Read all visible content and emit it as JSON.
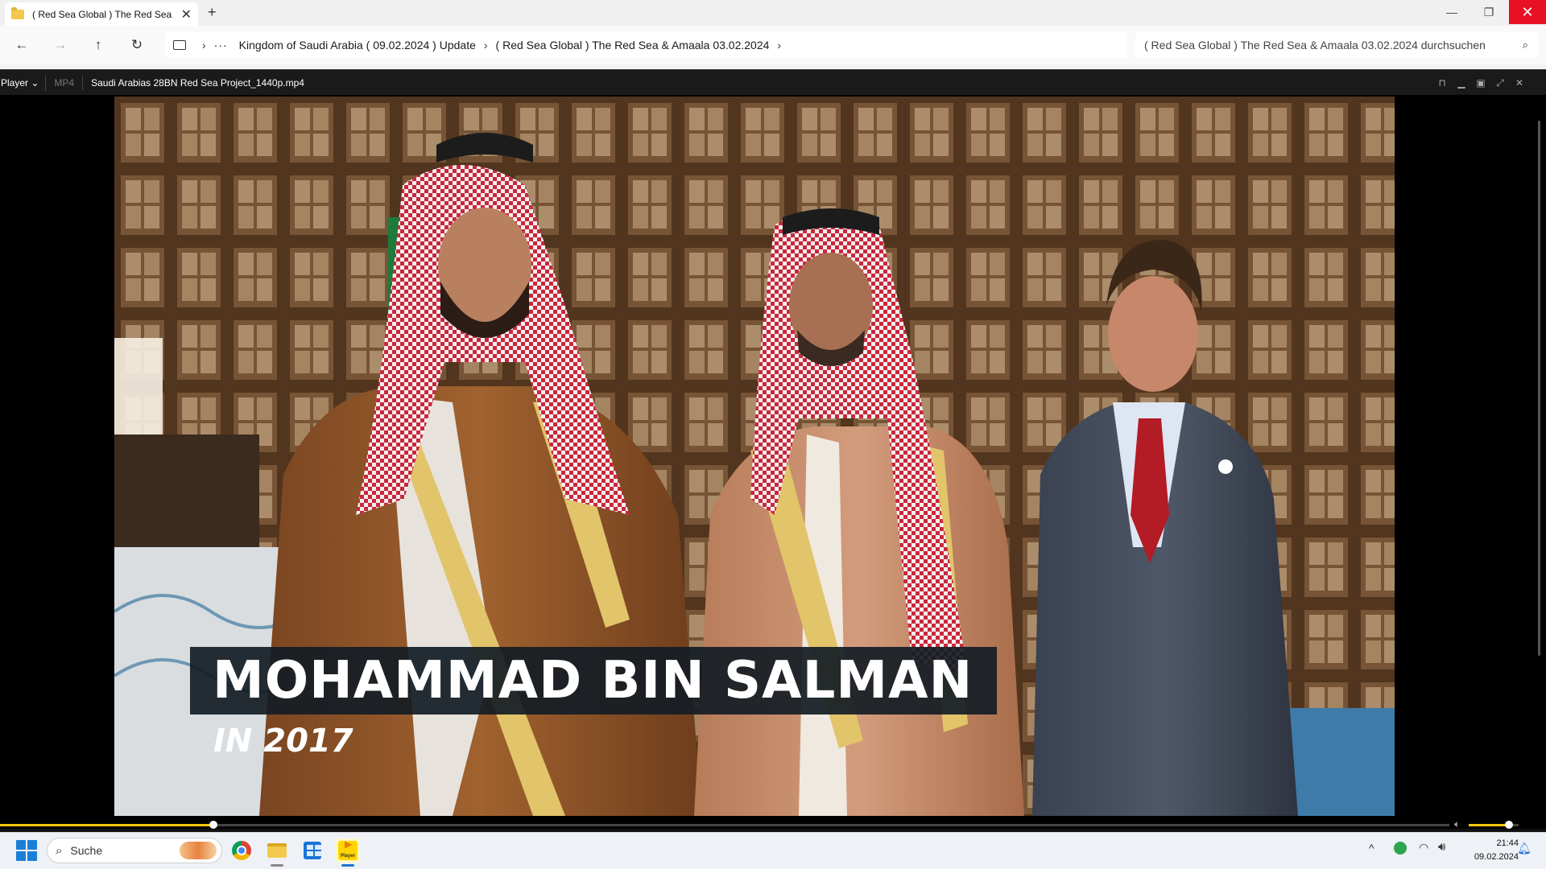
{
  "window": {
    "tab_title": "( Red Sea Global ) The Red Sea",
    "tab_close": "✕",
    "new_tab": "+",
    "minimize": "—",
    "restore": "❐",
    "close": "✕"
  },
  "nav": {
    "back": "←",
    "forward": "→",
    "up": "↑",
    "refresh": "↻",
    "more": "···",
    "breadcrumbs": [
      "Kingdom of Saudi Arabia ( 09.02.2024 ) Update",
      "( Red Sea Global ) The Red Sea & Amaala 03.02.2024"
    ],
    "separator": "›",
    "search_placeholder": "( Red Sea Global ) The Red Sea & Amaala 03.02.2024 durchsuchen",
    "search_icon": "search-icon"
  },
  "player": {
    "menu_label": "Player ⌄",
    "format": "MP4",
    "filename": "Saudi Arabias 28BN Red Sea Project_1440p.mp4",
    "controls": [
      "pin-icon",
      "minimize-icon",
      "maximize-icon",
      "fullscreen-icon",
      "close-icon"
    ],
    "progress_fraction": 0.147,
    "volume_fraction": 0.8,
    "accent_color": "#f1c40f"
  },
  "video": {
    "caption_name": "MOHAMMAD BIN SALMAN",
    "caption_year": "IN 2017"
  },
  "taskbar": {
    "search_label": "Suche",
    "apps": [
      "start-icon",
      "chrome-icon",
      "file-explorer-icon",
      "store-icon",
      "player-icon"
    ],
    "player_app_label": "Player",
    "time": "21:44",
    "date": "09.02.2024",
    "tray_chevron": "^"
  }
}
